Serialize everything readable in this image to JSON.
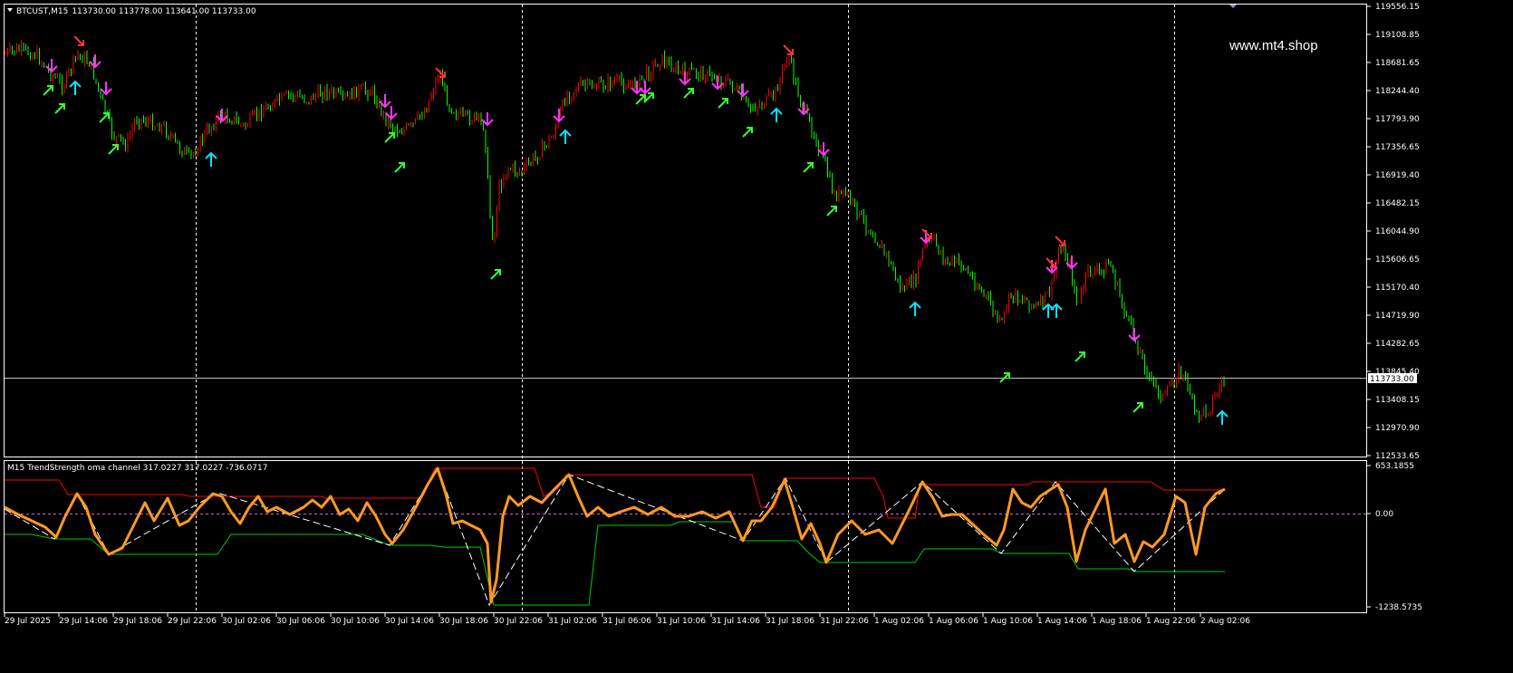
{
  "window": {
    "symbol_title": "BTCUST,M15",
    "ohlc": "113730.00 113778.00 113641.00 113733.00",
    "watermark": "www.mt4.shop"
  },
  "main_chart": {
    "price_axis": [
      "119556.15",
      "119108.85",
      "118681.65",
      "118244.40",
      "117793.90",
      "117356.65",
      "116919.40",
      "116482.15",
      "116044.90",
      "115606.65",
      "115170.40",
      "114719.90",
      "114282.65",
      "113845.40",
      "113408.15",
      "112970.90",
      "112533.65"
    ],
    "current_price": "113733.00",
    "price_range": [
      112533.65,
      119556.15
    ],
    "colors": {
      "bull": "#ff0000",
      "bear": "#00ff00",
      "up_arrow": "#00e5ff",
      "down_arrow": "#ff33ff",
      "green_arrow": "#33ff33",
      "current_line": "#c0c0c0"
    }
  },
  "indicator": {
    "title": "M15 TrendStrength oma channel 317.0227 317.0227 -736.0717",
    "axis": [
      "653.1855",
      "0.00",
      "-1238.5735"
    ],
    "range": [
      -1238.5735,
      653.1855
    ],
    "colors": {
      "line": "#ff9922",
      "upper": "#ff0000",
      "lower": "#00cc00",
      "zigzag": "#ffffff",
      "zero": "#cc66cc"
    }
  },
  "time_axis": [
    "29 Jul 2025",
    "29 Jul 14:06",
    "29 Jul 18:06",
    "29 Jul 22:06",
    "30 Jul 02:06",
    "30 Jul 06:06",
    "30 Jul 10:06",
    "30 Jul 14:06",
    "30 Jul 18:06",
    "30 Jul 22:06",
    "31 Jul 02:06",
    "31 Jul 06:06",
    "31 Jul 10:06",
    "31 Jul 14:06",
    "31 Jul 18:06",
    "31 Jul 22:06",
    "1 Aug 02:06",
    "1 Aug 06:06",
    "1 Aug 10:06",
    "1 Aug 14:06",
    "1 Aug 18:06",
    "1 Aug 22:06",
    "2 Aug 02:06"
  ]
}
